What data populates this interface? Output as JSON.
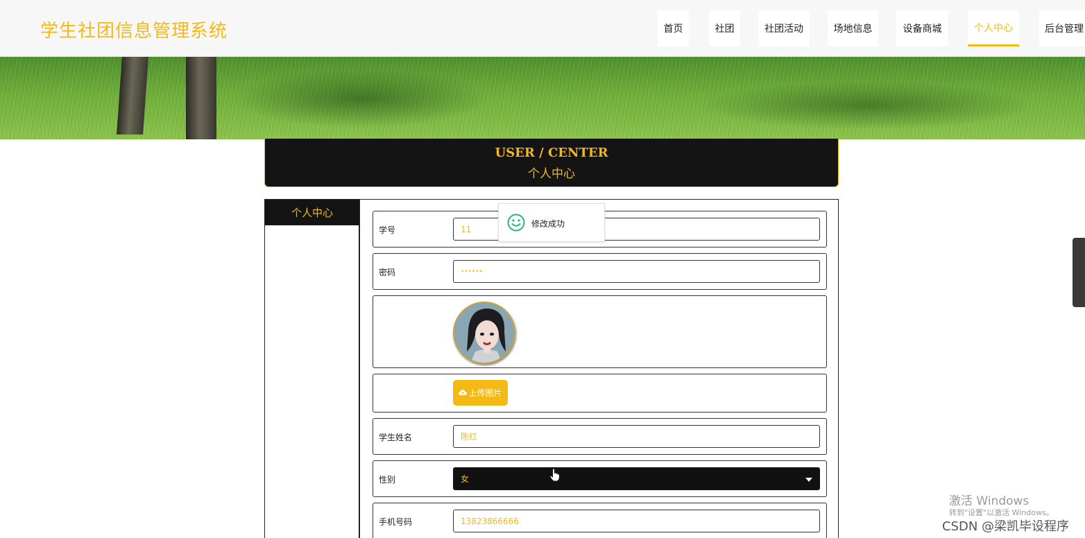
{
  "header": {
    "site_title": "学生社团信息管理系统",
    "nav": [
      {
        "label": "首页"
      },
      {
        "label": "社团"
      },
      {
        "label": "社团活动"
      },
      {
        "label": "场地信息"
      },
      {
        "label": "设备商城"
      },
      {
        "label": "个人中心",
        "active": true
      },
      {
        "label": "后台管理"
      }
    ]
  },
  "user_center": {
    "title_en": "USER / CENTER",
    "title_cn": "个人中心"
  },
  "sidebar": {
    "items": [
      {
        "label": "个人中心",
        "active": true
      }
    ]
  },
  "form": {
    "student_id": {
      "label": "学号",
      "value": "11"
    },
    "password": {
      "label": "密码",
      "value": "••••••"
    },
    "upload": {
      "label": "上传图片",
      "icon": "cloud-upload-icon"
    },
    "name": {
      "label": "学生姓名",
      "value": "陈红"
    },
    "gender": {
      "label": "性别",
      "value": "女"
    },
    "phone": {
      "label": "手机号码",
      "value": "13823866666"
    }
  },
  "toast": {
    "message": "修改成功",
    "icon": "smile-icon"
  },
  "watermark": {
    "activate_title": "激活 Windows",
    "activate_sub": "转到\"设置\"以激活 Windows。",
    "credit": "CSDN @梁凯毕设程序"
  },
  "colors": {
    "accent": "#f5b916",
    "dark": "#141414",
    "header_bg": "#f7f7f7"
  }
}
